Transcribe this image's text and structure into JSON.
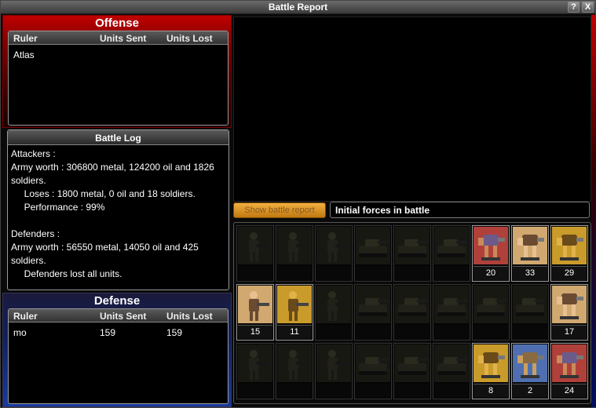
{
  "window": {
    "title": "Battle Report",
    "help_label": "?",
    "close_label": "X"
  },
  "offense": {
    "title": "Offense",
    "headers": {
      "ruler": "Ruler",
      "sent": "Units Sent",
      "lost": "Units Lost"
    },
    "rows": [
      {
        "ruler": "Atlas",
        "sent": "",
        "lost": ""
      }
    ]
  },
  "battle_log": {
    "title": "Battle Log",
    "lines": [
      "Attackers :",
      " Army worth : 306800 metal, 124200 oil and 1826",
      "soldiers.",
      "     Loses : 1800 metal, 0 oil and 18 soldiers.",
      "     Performance : 99%",
      "",
      "Defenders :",
      " Army worth : 56550 metal, 14050 oil and 425",
      "soldiers.",
      "     Defenders lost all units."
    ]
  },
  "defense": {
    "title": "Defense",
    "headers": {
      "ruler": "Ruler",
      "sent": "Units Sent",
      "lost": "Units Lost"
    },
    "rows": [
      {
        "ruler": "mo",
        "sent": "159",
        "lost": "159"
      }
    ]
  },
  "controls": {
    "show_battle_label": "Show battle report",
    "forces_label": "Initial forces in battle"
  },
  "colors": {
    "offense_red": "#c00000",
    "defense_blue": "#1a3aa0",
    "button_orange": "#f0b040"
  },
  "units": [
    [
      {
        "icon": "infantry-icon",
        "count": "",
        "active": false
      },
      {
        "icon": "infantry-icon",
        "count": "",
        "active": false
      },
      {
        "icon": "infantry-icon",
        "count": "",
        "active": false
      },
      {
        "icon": "tank-icon",
        "count": "",
        "active": false
      },
      {
        "icon": "tank-icon",
        "count": "",
        "active": false
      },
      {
        "icon": "tank-icon",
        "count": "",
        "active": false
      },
      {
        "icon": "mech-icon",
        "count": "20",
        "active": true
      },
      {
        "icon": "mech-icon",
        "count": "33",
        "active": true
      },
      {
        "icon": "mech-icon",
        "count": "29",
        "active": true
      }
    ],
    [
      {
        "icon": "infantry-icon",
        "count": "15",
        "active": true
      },
      {
        "icon": "infantry-icon",
        "count": "11",
        "active": true
      },
      {
        "icon": "infantry-icon",
        "count": "",
        "active": false
      },
      {
        "icon": "tank-icon",
        "count": "",
        "active": false
      },
      {
        "icon": "tank-icon",
        "count": "",
        "active": false
      },
      {
        "icon": "tank-icon",
        "count": "",
        "active": false
      },
      {
        "icon": "tank-icon",
        "count": "",
        "active": false
      },
      {
        "icon": "tank-icon",
        "count": "",
        "active": false
      },
      {
        "icon": "mech-icon",
        "count": "17",
        "active": true
      }
    ],
    [
      {
        "icon": "infantry-icon",
        "count": "",
        "active": false
      },
      {
        "icon": "infantry-icon",
        "count": "",
        "active": false
      },
      {
        "icon": "infantry-icon",
        "count": "",
        "active": false
      },
      {
        "icon": "tank-icon",
        "count": "",
        "active": false
      },
      {
        "icon": "tank-icon",
        "count": "",
        "active": false
      },
      {
        "icon": "tank-icon",
        "count": "",
        "active": false
      },
      {
        "icon": "mech-icon",
        "count": "8",
        "active": true
      },
      {
        "icon": "mech-icon",
        "count": "2",
        "active": true
      },
      {
        "icon": "mech-icon",
        "count": "24",
        "active": true
      }
    ]
  ]
}
